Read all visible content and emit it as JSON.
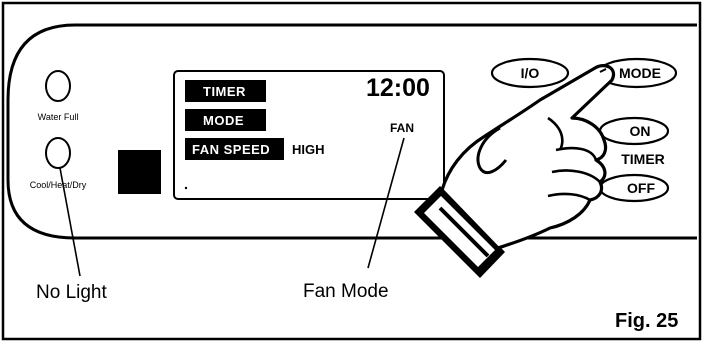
{
  "figure": {
    "label": "Fig. 25"
  },
  "indicators": {
    "water_full": "Water Full",
    "cool_heat_dry": "Cool/Heat/Dry"
  },
  "display": {
    "timer_label": "TIMER",
    "mode_label": "MODE",
    "fan_speed_label": "FAN SPEED",
    "fan_speed_value": "HIGH",
    "clock": "12:00",
    "mode_value": "FAN"
  },
  "buttons": {
    "power": "I/O",
    "mode": "MODE",
    "timer_on": "ON",
    "timer_label": "TIMER",
    "timer_off": "OFF"
  },
  "callouts": {
    "no_light": "No Light",
    "fan_mode": "Fan Mode"
  },
  "colors": {
    "ink": "#000000",
    "paper": "#ffffff"
  }
}
